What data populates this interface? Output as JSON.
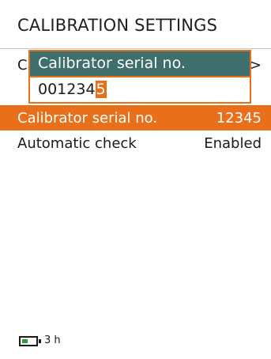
{
  "header": {
    "title": "CALIBRATION SETTINGS"
  },
  "rows": [
    {
      "label": "Ca",
      "value": ">"
    },
    {
      "label": "Calibrator serial no.",
      "value": "12345"
    },
    {
      "label": "Automatic check",
      "value": "Enabled"
    }
  ],
  "dialog": {
    "title": "Calibrator serial no.",
    "value_prefix": "001234",
    "value_cursor": "5"
  },
  "status": {
    "battery_time": "3 h",
    "battery_icon": "battery-icon",
    "battery_level_fraction": 0.25
  },
  "colors": {
    "accent": "#e8701a",
    "dialog_header": "#3f6f6c",
    "battery_green": "#2e9a3a"
  }
}
